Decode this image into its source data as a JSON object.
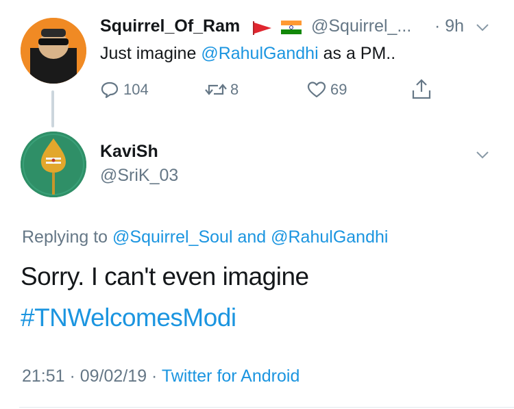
{
  "parent": {
    "display_name": "Squirrel_Of_Ram",
    "handle": "@Squirrel_...",
    "time": "· 9h",
    "text_before": "Just imagine",
    "mention": "@RahulGandhi",
    "text_after": "as a PM..",
    "replies": "104",
    "retweets": "8",
    "likes": "69"
  },
  "reply": {
    "display_name": "KaviSh",
    "handle": "@SriK_03",
    "replying_prefix": "Replying to",
    "replying_user1": "@Squirrel_Soul",
    "replying_and": "and",
    "replying_user2": "@RahulGandhi",
    "text": "Sorry. I can't even imagine",
    "hashtag": "#TNWelcomesModi",
    "timestamp": "21:51 · 09/02/19 ·",
    "source": "Twitter for Android"
  },
  "colors": {
    "link": "#1b95e0",
    "secondary": "#657786",
    "avatar_green": "#2f8f67",
    "avatar_orange": "#f08a24"
  },
  "icons": [
    "reply-icon",
    "retweet-icon",
    "like-icon",
    "share-icon",
    "chevron-down-icon",
    "red-flag-icon",
    "india-flag-icon"
  ]
}
